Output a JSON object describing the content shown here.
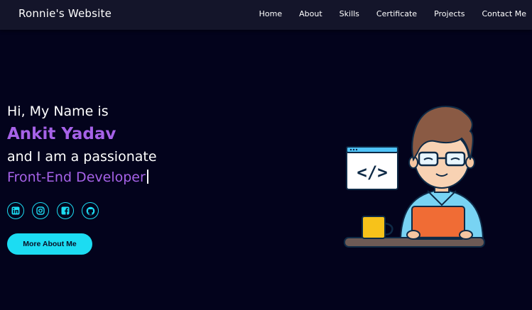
{
  "nav": {
    "brand": "Ronnie's Website",
    "links": [
      "Home",
      "About",
      "Skills",
      "Certificate",
      "Projects",
      "Contact Me"
    ]
  },
  "hero": {
    "greeting": "Hi, My Name is",
    "name": "Ankit Yadav",
    "intro": "and I am a passionate",
    "role": "Front-End Developer",
    "cta_label": "More About Me"
  },
  "socials": [
    {
      "icon": "linkedin-icon"
    },
    {
      "icon": "instagram-icon"
    },
    {
      "icon": "facebook-icon"
    },
    {
      "icon": "github-icon"
    }
  ],
  "illustration": {
    "code_symbol": "</>"
  },
  "colors": {
    "background": "#03031c",
    "navbar": "#14152a",
    "accent_purple": "#a662e8",
    "accent_cyan": "#1cdcf2"
  }
}
